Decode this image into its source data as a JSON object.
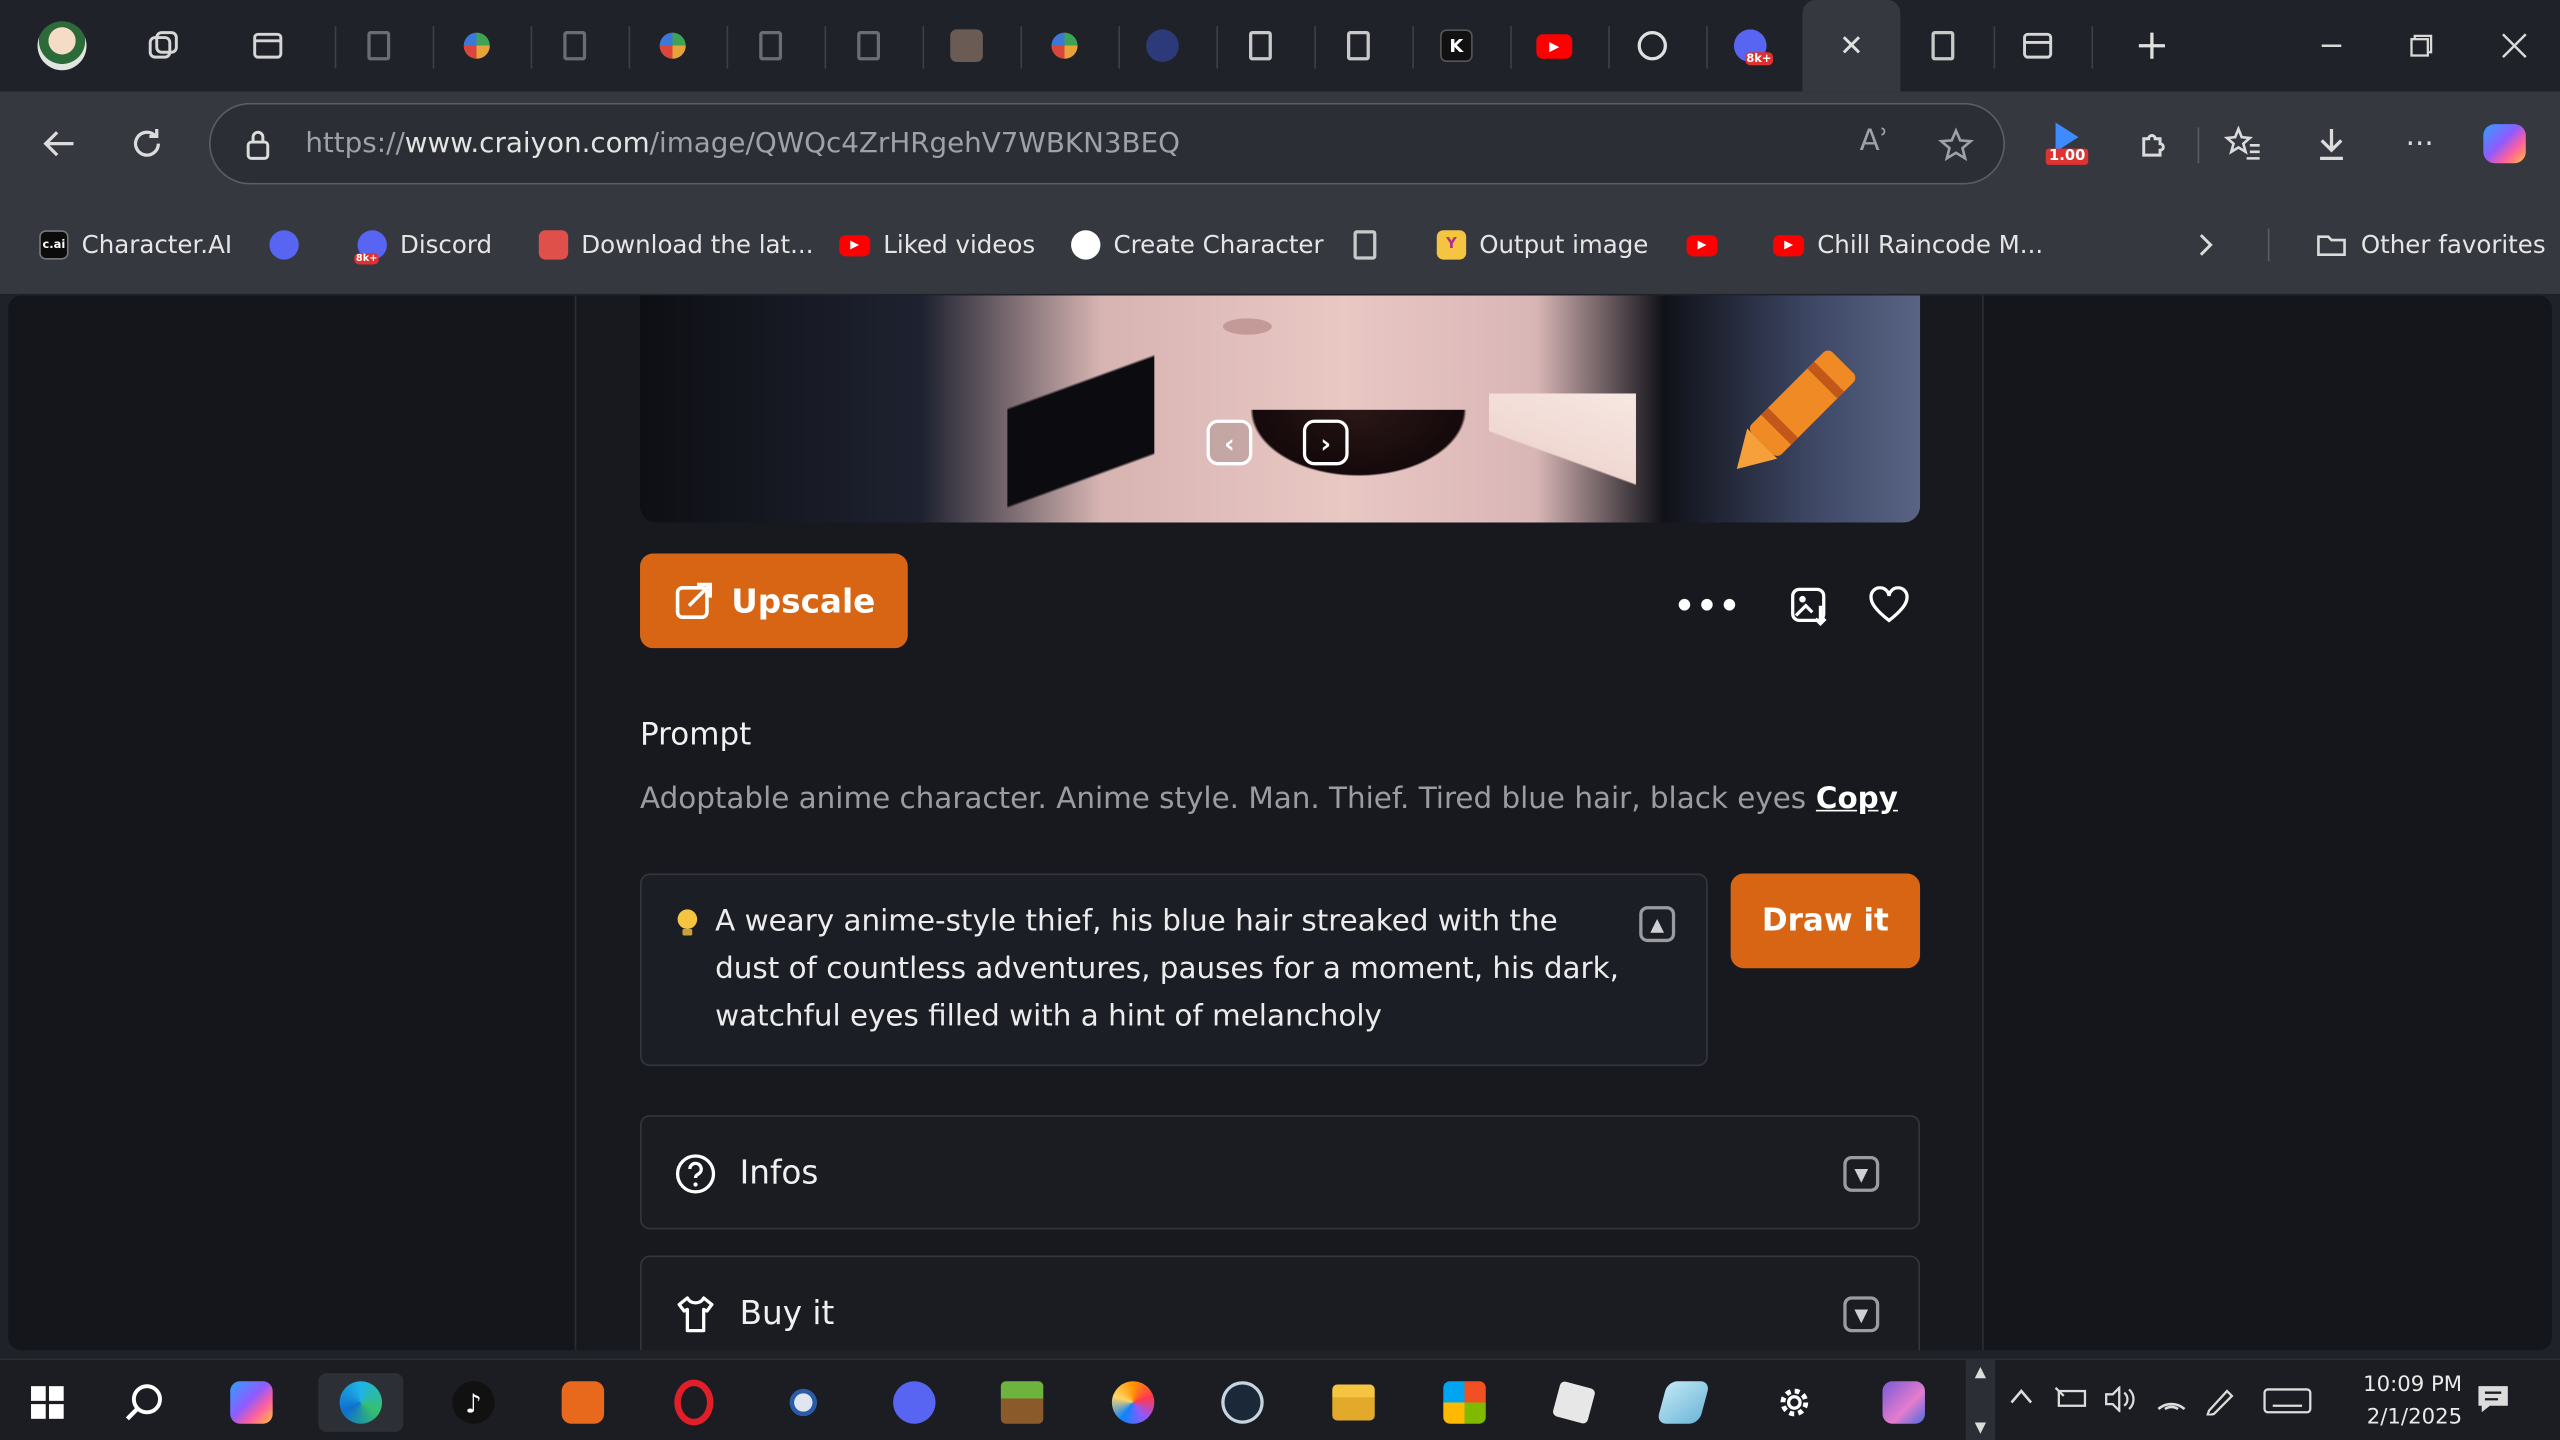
{
  "browser": {
    "url_prefix": "https://",
    "url_host": "www.craiyon.com",
    "url_path": "/image/QWQc4ZrHRgehV7WBKN3BEQ",
    "read_aloud_glyph": "Aʾ",
    "extension_badge": "1.00",
    "active_tab_close": "✕"
  },
  "tabs": [
    {
      "icon": "doc-icon"
    },
    {
      "icon": "pinwheel-icon"
    },
    {
      "icon": "doc-icon"
    },
    {
      "icon": "pinwheel-icon"
    },
    {
      "icon": "doc-icon"
    },
    {
      "icon": "doc-icon"
    },
    {
      "icon": "image-thumb-icon"
    },
    {
      "icon": "pinwheel-icon"
    },
    {
      "icon": "shield-icon"
    },
    {
      "icon": "doc-icon"
    },
    {
      "icon": "doc-icon"
    },
    {
      "icon": "k-icon",
      "text": "K"
    },
    {
      "icon": "youtube-icon"
    },
    {
      "icon": "openai-icon"
    },
    {
      "icon": "discord-8k-icon",
      "text": "8k+"
    }
  ],
  "favorites": [
    {
      "label": "Character.AI",
      "icon": "cai-icon",
      "text": "c.ai"
    },
    {
      "label": "",
      "icon": "discord-icon"
    },
    {
      "label": "Discord",
      "icon": "discord-8k-icon",
      "text": "8k+"
    },
    {
      "label": "Download the lat...",
      "icon": "download-store-icon"
    },
    {
      "label": "Liked videos",
      "icon": "youtube-icon"
    },
    {
      "label": "Create Character",
      "icon": "openai-icon"
    },
    {
      "label": "",
      "icon": "doc-icon"
    },
    {
      "label": "Output image",
      "icon": "y-icon",
      "text": "Y"
    },
    {
      "label": "",
      "icon": "youtube-icon"
    },
    {
      "label": "Chill Raincode M...",
      "icon": "youtube-icon"
    },
    {
      "label": "Other favorites",
      "icon": "folder-icon"
    }
  ],
  "page": {
    "upscale_label": "Upscale",
    "prompt_heading": "Prompt",
    "prompt_text": "Adoptable anime character. Anime style. Man. Thief. Tired blue hair, black eyes",
    "copy_label": "Copy",
    "enhanced_prompt": "A weary anime-style thief, his blue hair streaked with the dust of countless adventures, pauses for a moment, his dark, watchful eyes filled with a hint of melancholy",
    "draw_label": "Draw it",
    "infos_label": "Infos",
    "buy_label": "Buy it",
    "more_glyph": "•••",
    "prev_glyph": "‹",
    "next_glyph": "›"
  },
  "taskbar": {
    "time": "10:09 PM",
    "date": "2/1/2025",
    "apps": [
      "start",
      "search",
      "copilot",
      "edge",
      "tiktok",
      "photos-editor",
      "opera",
      "spider-app",
      "discord",
      "minecraft",
      "firefox",
      "steam",
      "file-explorer",
      "microsoft-store",
      "roblox",
      "notepad-app",
      "settings",
      "game-avatar"
    ]
  },
  "colors": {
    "accent_orange": "#d86514",
    "page_bg": "#17191f",
    "chrome_bg": "#35383f"
  }
}
